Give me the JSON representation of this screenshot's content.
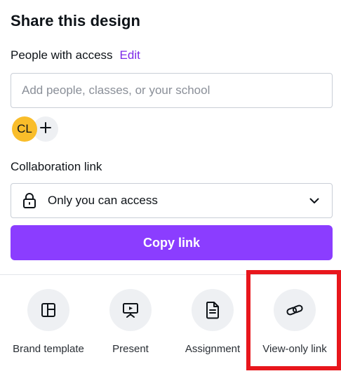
{
  "panel": {
    "title": "Share this design"
  },
  "access": {
    "label": "People with access",
    "edit_link": "Edit",
    "input_placeholder": "Add people, classes, or your school",
    "avatar_initials": "CL",
    "avatar_color": "#f9bd2a",
    "add_person_symbol": "+"
  },
  "collaboration": {
    "label": "Collaboration link",
    "selected_option": "Only you can access",
    "lock_icon": "lock-icon",
    "dropdown_icon": "chevron-down-icon"
  },
  "copy_link_button": {
    "label": "Copy link",
    "color": "#8b3dff"
  },
  "actions": [
    {
      "label": "Brand template",
      "icon": "brand-template-icon"
    },
    {
      "label": "Present",
      "icon": "present-icon"
    },
    {
      "label": "Assignment",
      "icon": "assignment-icon"
    },
    {
      "label": "View-only link",
      "icon": "link-icon"
    }
  ],
  "highlight_color": "#e8161c"
}
